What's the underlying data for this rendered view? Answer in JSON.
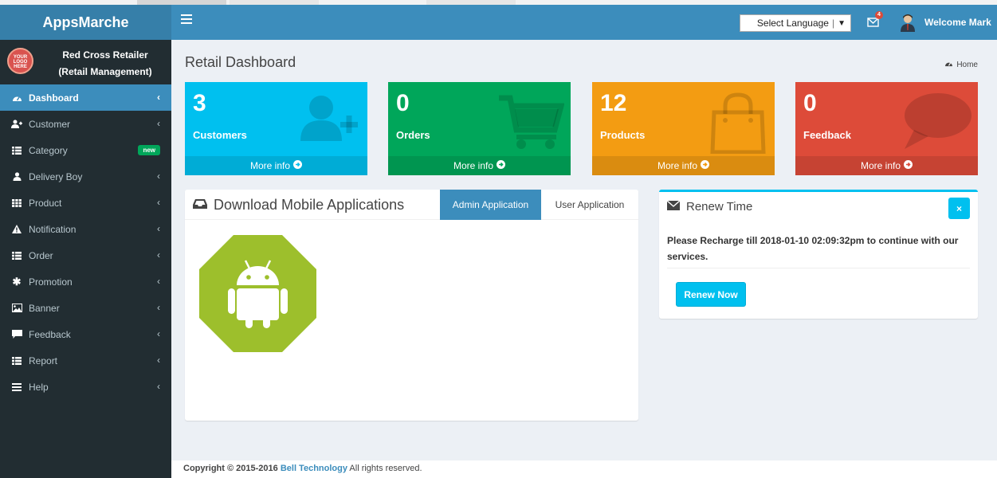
{
  "sidebar": {
    "brand": "AppsMarche",
    "logo_text": "YOUR LOGO HERE",
    "user_line1": "Red Cross Retailer",
    "user_line2": "(Retail Management)",
    "items": [
      {
        "label": "Dashboard",
        "icon": "dashboard-icon"
      },
      {
        "label": "Customer",
        "icon": "user-plus-icon"
      },
      {
        "label": "Category",
        "icon": "list-icon",
        "badge": "new"
      },
      {
        "label": "Delivery Boy",
        "icon": "user-icon"
      },
      {
        "label": "Product",
        "icon": "grid-icon"
      },
      {
        "label": "Notification",
        "icon": "warning-icon"
      },
      {
        "label": "Order",
        "icon": "list-icon"
      },
      {
        "label": "Promotion",
        "icon": "asterisk-icon"
      },
      {
        "label": "Banner",
        "icon": "image-icon"
      },
      {
        "label": "Feedback",
        "icon": "comment-icon"
      },
      {
        "label": "Report",
        "icon": "list-icon"
      },
      {
        "label": "Help",
        "icon": "bars-icon"
      }
    ]
  },
  "navbar": {
    "language_select": "Select Language",
    "mail_count": "4",
    "welcome": "Welcome Mark"
  },
  "page": {
    "title": "Retail Dashboard",
    "breadcrumb": "Home"
  },
  "stats": [
    {
      "value": "3",
      "label": "Customers",
      "more": "More info",
      "color": "#00c0ef",
      "icon": "user-plus-icon"
    },
    {
      "value": "0",
      "label": "Orders",
      "more": "More info",
      "color": "#00a65a",
      "icon": "cart-icon"
    },
    {
      "value": "12",
      "label": "Products",
      "more": "More info",
      "color": "#f39c12",
      "icon": "bag-icon"
    },
    {
      "value": "0",
      "label": "Feedback",
      "more": "More info",
      "color": "#dd4b39",
      "icon": "comment-icon"
    }
  ],
  "download": {
    "title": "Download Mobile Applications",
    "tab_admin": "Admin Application",
    "tab_user": "User Application"
  },
  "renew": {
    "title": "Renew Time",
    "close": "×",
    "message": "Please Recharge till 2018-01-10 02:09:32pm to continue with our services.",
    "button": "Renew Now"
  },
  "footer": {
    "prefix": "Copyright © 2015-2016 ",
    "company": "Bell Technology",
    "suffix": " All rights reserved."
  }
}
